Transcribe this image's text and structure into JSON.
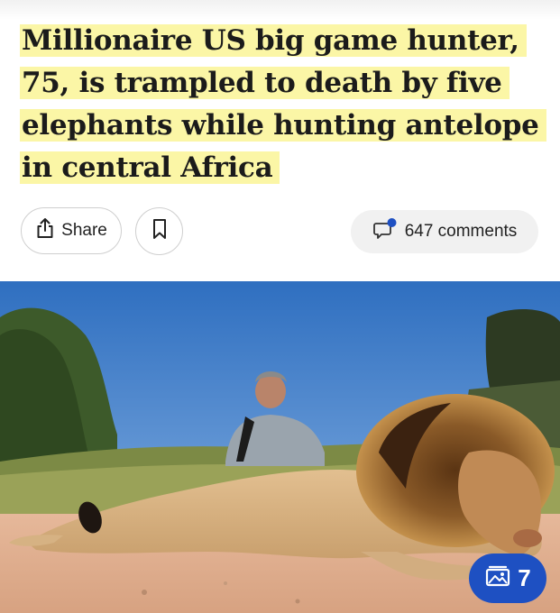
{
  "article": {
    "headline_lines": [
      "Millionaire US big game hunter,",
      "75, is trampled to death by five",
      "elephants while hunting antelope",
      "in central Africa"
    ],
    "highlight_color": "#fbf6a6"
  },
  "actions": {
    "share_label": "Share",
    "share_icon": "share-icon",
    "bookmark_icon": "bookmark-icon",
    "comments_label": "647 comments",
    "comments_icon": "comment-bubble-icon",
    "unread_dot_color": "#1e50c2"
  },
  "photo": {
    "gallery_count": "7",
    "gallery_icon": "photo-gallery-icon",
    "badge_color": "#1e50c2"
  }
}
